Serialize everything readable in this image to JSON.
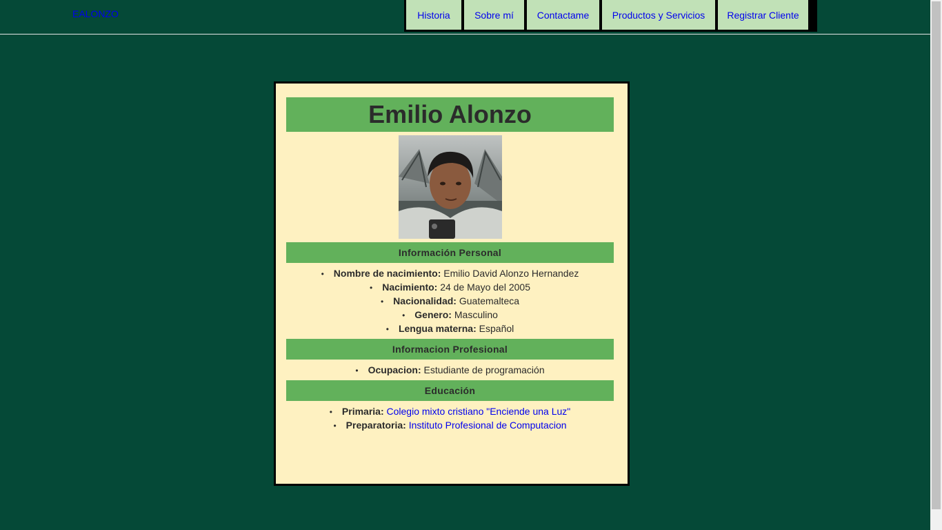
{
  "brand": "EALONZO",
  "nav": [
    {
      "label": "Historia"
    },
    {
      "label": "Sobre mí"
    },
    {
      "label": "Contactame"
    },
    {
      "label": "Productos y Servicios"
    },
    {
      "label": "Registrar Cliente"
    }
  ],
  "profile": {
    "name": "Emilio Alonzo"
  },
  "sections": {
    "personal": {
      "title": "Información Personal",
      "items": [
        {
          "label": "Nombre de nacimiento:",
          "value": "Emilio David Alonzo Hernandez"
        },
        {
          "label": "Nacimiento:",
          "value": "24 de Mayo del 2005"
        },
        {
          "label": "Nacionalidad:",
          "value": "Guatemalteca"
        },
        {
          "label": "Genero:",
          "value": "Masculino"
        },
        {
          "label": "Lengua materna:",
          "value": "Español"
        }
      ]
    },
    "professional": {
      "title": "Informacion Profesional",
      "items": [
        {
          "label": "Ocupacion:",
          "value": "Estudiante de programación"
        }
      ]
    },
    "education": {
      "title": "Educación",
      "items": [
        {
          "label": "Primaria:",
          "link": "Colegio mixto cristiano \"Enciende una Luz\""
        },
        {
          "label": "Preparatoria:",
          "link": "Instituto Profesional de Computacion"
        }
      ]
    }
  },
  "colors": {
    "background": "#054937",
    "card": "#fef1c1",
    "section": "#62b15b",
    "nav_item": "#c1e1b7",
    "link": "#0000ee"
  }
}
